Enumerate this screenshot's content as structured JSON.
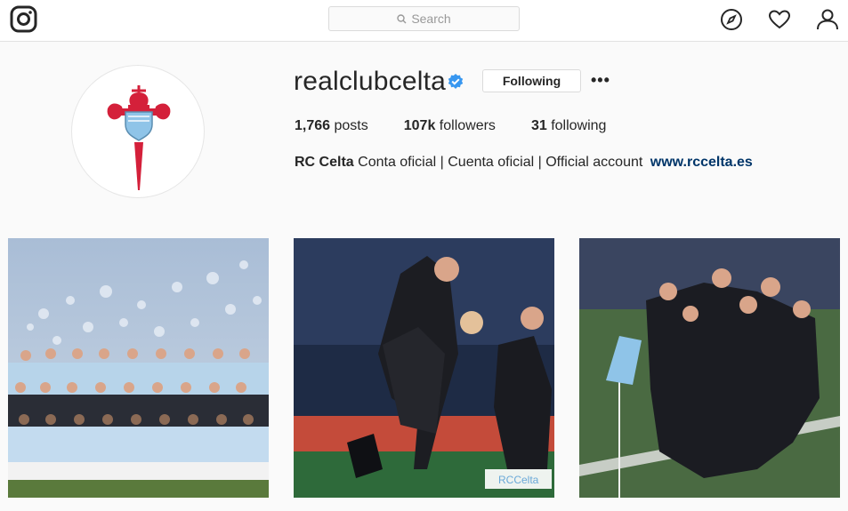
{
  "header": {
    "search_placeholder": "Search",
    "icons": [
      "instagram-logo-icon",
      "compass-icon",
      "heart-icon",
      "person-icon"
    ]
  },
  "profile": {
    "username": "realclubcelta",
    "verified": true,
    "follow_button_label": "Following",
    "more_label": "•••",
    "stats": {
      "posts_count": "1,766",
      "posts_label": "posts",
      "followers_count": "107k",
      "followers_label": "followers",
      "following_count": "31",
      "following_label": "following"
    },
    "bio": {
      "name": "RC Celta",
      "text": "Conta oficial | Cuenta oficial | Official account",
      "link": "www.rccelta.es"
    }
  },
  "posts": [
    {
      "description": "team-photo"
    },
    {
      "description": "players-celebrating",
      "watermark": "RCCelta"
    },
    {
      "description": "group-hug-celebration"
    }
  ],
  "colors": {
    "accent_blue": "#3897f0",
    "link": "#003569",
    "celta_red": "#d4203a",
    "celta_sky": "#8fc4e8"
  }
}
